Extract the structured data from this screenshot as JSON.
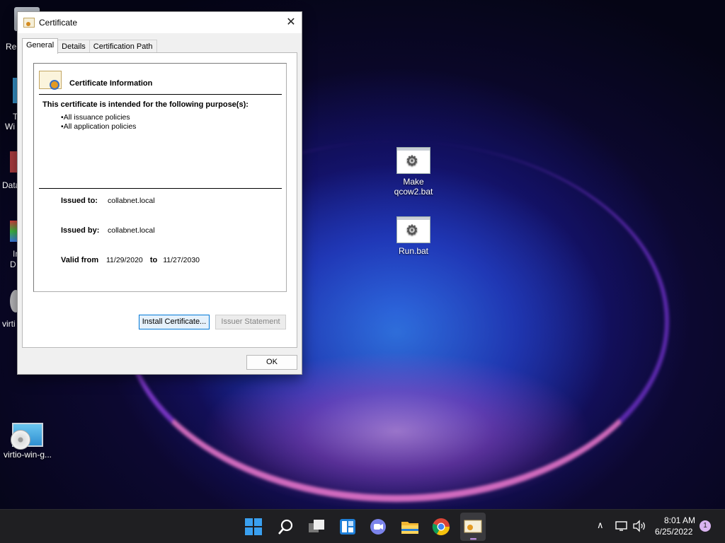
{
  "desktop": {
    "partial_labels": [
      "Re",
      "T",
      "Wi",
      "Data",
      "In",
      "D",
      "virti"
    ],
    "icons": [
      {
        "label_line1": "Make",
        "label_line2": "qcow2.bat"
      },
      {
        "label_line1": "Run.bat",
        "label_line2": ""
      },
      {
        "label_line1": "virtio-win-g...",
        "label_line2": ""
      }
    ]
  },
  "dialog": {
    "title": "Certificate",
    "close_glyph": "✕",
    "tabs": [
      {
        "label": "General",
        "active": true
      },
      {
        "label": "Details",
        "active": false
      },
      {
        "label": "Certification Path",
        "active": false
      }
    ],
    "info_title": "Certificate Information",
    "purpose_heading": "This certificate is intended for the following purpose(s):",
    "purposes": [
      "All issuance policies",
      "All application policies"
    ],
    "issued_to_label": "Issued to:",
    "issued_to": "collabnet.local",
    "issued_by_label": "Issued by:",
    "issued_by": "collabnet.local",
    "valid_from_label": "Valid from",
    "valid_from": "11/29/2020",
    "to_label": "to",
    "valid_to": "11/27/2030",
    "install_button": "Install Certificate...",
    "issuer_statement_button": "Issuer Statement",
    "ok_button": "OK"
  },
  "taskbar": {
    "time": "8:01 AM",
    "date": "6/25/2022",
    "notification_count": "1",
    "icons": [
      "windows-start",
      "search",
      "task-view",
      "widgets",
      "teams-chat",
      "file-explorer",
      "chrome",
      "certificate-app"
    ]
  },
  "colors": {
    "accent": "#0078d7",
    "taskbar": "#1f1f22"
  }
}
